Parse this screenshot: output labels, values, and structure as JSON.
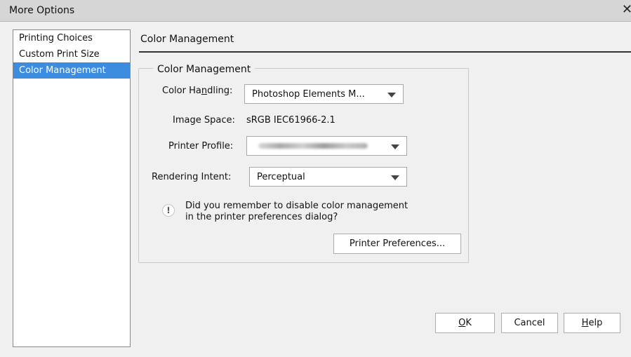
{
  "window": {
    "title": "More Options",
    "close_glyph": "✕"
  },
  "sidebar": {
    "items": [
      {
        "label": "Printing Choices",
        "selected": false
      },
      {
        "label": "Custom Print Size",
        "selected": false
      },
      {
        "label": "Color Management",
        "selected": true
      }
    ]
  },
  "main": {
    "heading": "Color Management",
    "group": {
      "legend": "Color Management",
      "color_handling": {
        "label_pre": "Color Ha",
        "label_mnemonic": "n",
        "label_post": "dling:",
        "value": "Photoshop Elements M..."
      },
      "image_space": {
        "label": "Image Space:",
        "value": "sRGB IEC61966-2.1"
      },
      "printer_profile": {
        "label": "Printer Profile:",
        "value": ""
      },
      "rendering_intent": {
        "label": "Rendering Intent:",
        "value": "Perceptual"
      },
      "note_line1": "Did you remember to disable color management",
      "note_line2": "in the printer preferences dialog?",
      "printer_prefs_button": "Printer Preferences..."
    }
  },
  "footer": {
    "ok": {
      "mnemonic": "O",
      "rest": "K"
    },
    "cancel": "Cancel",
    "help": {
      "mnemonic": "H",
      "rest": "elp"
    }
  },
  "colors": {
    "selection": "#3c8de0",
    "background": "#f0f0f0",
    "titlebar": "#d6d6d6"
  },
  "icons": [
    "close-icon",
    "info-icon",
    "chevron-down-icon"
  ]
}
